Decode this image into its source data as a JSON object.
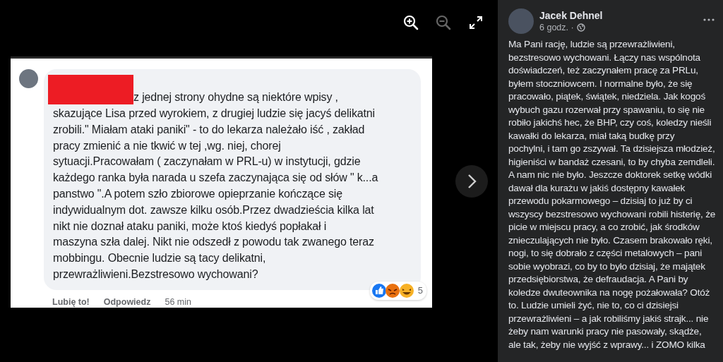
{
  "viewer": {
    "toolbar": [
      {
        "kind": "zoom-in",
        "disabled": false
      },
      {
        "kind": "zoom-out",
        "disabled": true
      },
      {
        "kind": "fullscreen",
        "disabled": false
      }
    ],
    "photo": {
      "comment": {
        "lines": [
          "z jednej strony ohydne są niektóre wpisy ,",
          "skazujące Lisa przed wyrokiem, z drugiej ludzie się jacyś delikatni",
          "zrobili.\" Miałam ataki paniki\" - to do lekarza należało iść , zakład",
          "pracy zmienić a nie tkwić w tej ,wg. niej, chorej",
          "sytuacji.Pracowałam ( zaczynałam w PRL-u) w instytucji, gdzie",
          "każdego ranka była narada u szefa zaczynająca się od słów \" k...a",
          "panstwo \".A potem szło zbiorowe opieprzanie kończące się",
          "indywidualnym dot. zawsze kilku osób.Przez dwadzieścia kilka lat",
          "nikt nie doznał ataku paniki, może ktoś kiedyś popłakał i",
          "maszyna szła dalej. Nikt nie odszedł z powodu tak zwanego teraz",
          "mobbingu. Obecnie ludzie są tacy delikatni,",
          "przewrażliwieni.Bezstresowo wychowani?"
        ],
        "actions": [
          "Lubię to!",
          "Odpowiedz"
        ],
        "time": "56 min",
        "reaction_count": "5"
      }
    }
  },
  "post": {
    "author": "Jacek Dehnel",
    "time": "6 godz. ·",
    "lines": [
      "Ma Pani rację, ludzie są przewrażliwieni,",
      "bezstresowo wychowani. Łączy nas wspólnota",
      "doświadczeń, też zaczynałem pracę za PRLu,",
      "byłem stoczniowcem. I normalne było, że się",
      "pracowało, piątek, świątek, niedziela. Jak kogoś",
      "wybuch gazu rozerwał przy spawaniu, to się nie",
      "robiło jakichś hec, że BHP, czy coś, koledzy nieśli",
      "kawałki do lekarza, miał taką budkę przy",
      "pochylni, i tam go zszywał. Ta dzisiejsza młodzież,",
      "higieniści w bandaż czesani, to by chyba zemdleli.",
      "A nam nic nie było. Jeszcze doktorek setkę wódki",
      "dawał dla kurażu w jakiś dostępny kawałek",
      "przewodu pokarmowego – dzisiaj to już by ci",
      "wszyscy bezstresowo wychowani robili histerię, że",
      "picie w miejscu pracy, a co zrobić, jak środków",
      "znieczulających nie było. Czasem brakowało ręki,",
      "nogi, to się dobrało z części metalowych – pani",
      "sobie wyobrazi, co by to było dzisiaj, że majątek",
      "przedsiębiorstwa, że defraudacja. A Pani by",
      "koledze dwuteownika na nogę pożałowała? Otóż",
      "to. Ludzie umieli żyć, nie to, co ci dzisiejsi",
      "przewrażliwieni – a jak robiliśmy jakiś strajk... nie",
      "żeby nam warunki pracy nie pasowały, skądże,",
      "ale tak, żeby nie wyjść z wprawy... i ZOMO kilka"
    ]
  }
}
